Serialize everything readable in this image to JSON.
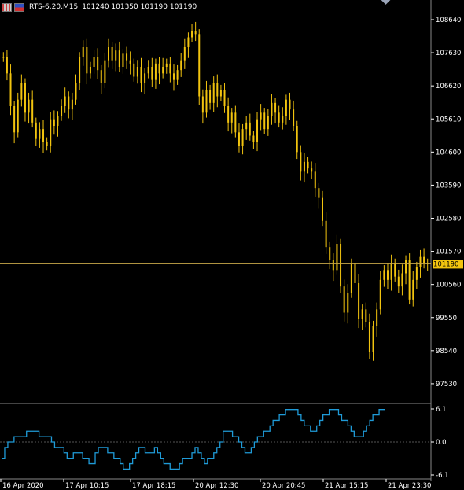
{
  "header": {
    "title": "RTS-6.20,M15",
    "values": "101240 101350 101190 101190",
    "icons": [
      "chart-grid-icon",
      "country-flag-icon"
    ]
  },
  "colors": {
    "background": "#000000",
    "candle": "#f2c40f",
    "indicator": "#1f9bd8",
    "price_line": "#c8a84a",
    "price_label_bg": "#f2c40f",
    "price_label_text": "#000000",
    "axis": "#ffffff",
    "zero_line": "#555555"
  },
  "chart_data": [
    {
      "type": "line",
      "subtype": "candlestick-price",
      "ylim": [
        97000,
        109000
      ],
      "yticks": [
        108640,
        107630,
        106620,
        105610,
        104600,
        103590,
        102580,
        101570,
        100560,
        99550,
        98540,
        97530
      ],
      "current_price": 101190,
      "current_price_label": "101190",
      "x_tick_labels": [
        "16 Apr 2020",
        "17 Apr 10:15",
        "17 Apr 18:15",
        "20 Apr 12:30",
        "20 Apr 20:45",
        "21 Apr 15:15",
        "21 Apr 23:30"
      ],
      "series": [
        {
          "values": [
            107500,
            107000,
            106000,
            105200,
            106200,
            106700,
            105800,
            106200,
            105500,
            105000,
            105300,
            104900,
            104800,
            105600,
            105400,
            105700,
            106000,
            106300,
            105900,
            106200,
            106700,
            107500,
            107800,
            107000,
            107200,
            107500,
            107100,
            106700,
            107400,
            107800,
            107400,
            107700,
            107200,
            107600,
            107400,
            107300,
            106900,
            107200,
            106700,
            107000,
            107200,
            106800,
            107300,
            107000,
            107200,
            107300,
            107000,
            106800,
            107100,
            107400,
            107800,
            108100,
            108300,
            108200,
            106300,
            105800,
            106500,
            106100,
            106700,
            106300,
            106500,
            106000,
            105500,
            105800,
            105200,
            104800,
            105300,
            105500,
            105100,
            104900,
            105600,
            105800,
            105300,
            105700,
            106100,
            105800,
            105500,
            105700,
            106200,
            105900,
            105400,
            104600,
            104000,
            104300,
            104100,
            104000,
            103500,
            103200,
            102500,
            101700,
            101300,
            101000,
            101800,
            100500,
            99700,
            100300,
            101200,
            100600,
            99500,
            99800,
            99400,
            98500,
            99300,
            99800,
            100700,
            101000,
            100700,
            101200,
            100800,
            100500,
            100900,
            101300,
            100100,
            100700,
            101100,
            101400,
            101200,
            101190
          ],
          "lows_note": ""
        }
      ]
    },
    {
      "type": "line",
      "subtype": "oscillator",
      "ylim": [
        -6.1,
        6.1
      ],
      "yticks": [
        6.1,
        0.0,
        -6.1
      ],
      "ytick_labels": [
        "6.1",
        "0.0",
        "-6.1"
      ],
      "series": [
        {
          "values": [
            -3,
            -1,
            0,
            0,
            1,
            1,
            1,
            1,
            2,
            2,
            2,
            2,
            1,
            1,
            1,
            1,
            0,
            -1,
            -1,
            -1,
            -2,
            -3,
            -3,
            -2,
            -2,
            -2,
            -3,
            -3,
            -4,
            -4,
            -2,
            -1,
            -1,
            -1,
            -2,
            -2,
            -3,
            -3,
            -4,
            -5,
            -5,
            -4,
            -3,
            -2,
            -1,
            -1,
            -2,
            -2,
            -2,
            -1,
            -2,
            -3,
            -4,
            -4,
            -5,
            -5,
            -5,
            -4,
            -3,
            -3,
            -3,
            -2,
            -1,
            -2,
            -3,
            -4,
            -3,
            -3,
            -2,
            -1,
            0,
            2,
            2,
            2,
            1,
            1,
            0,
            -1,
            -2,
            -2,
            -1,
            0,
            1,
            1,
            2,
            2,
            3,
            4,
            4,
            5,
            5,
            6,
            6,
            6,
            6,
            5,
            4,
            3,
            3,
            2,
            2,
            3,
            4,
            5,
            5,
            6,
            6,
            6,
            5,
            4,
            4,
            3,
            2,
            1,
            1,
            1,
            2,
            3,
            4,
            5,
            5,
            6,
            6
          ],
          "display_values": "ignore"
        }
      ]
    }
  ]
}
